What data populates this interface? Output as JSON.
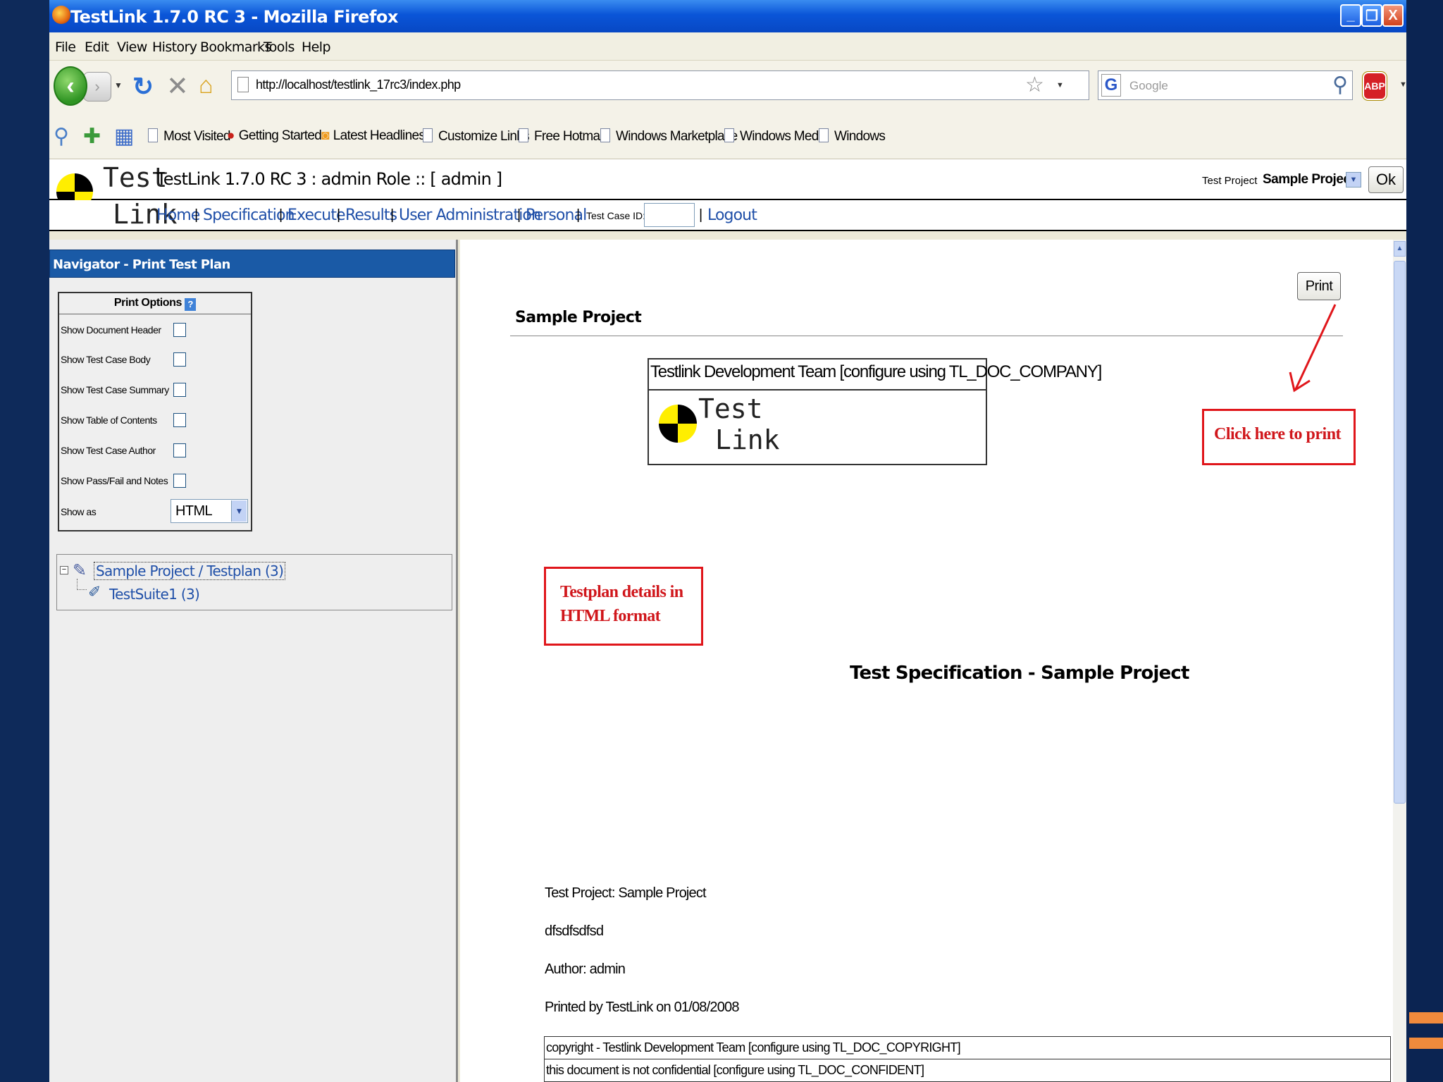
{
  "window": {
    "title": "TestLink 1.7.0 RC 3 - Mozilla Firefox",
    "minimize": "_",
    "restore": "❐",
    "close": "X"
  },
  "menu": [
    "File",
    "Edit",
    "View",
    "History",
    "Bookmarks",
    "Tools",
    "Help"
  ],
  "navbar": {
    "url": "http://localhost/testlink_17rc3/index.php",
    "search_placeholder": "Google",
    "adblock_label": "ABP"
  },
  "bookmarks": [
    "Most Visited",
    "Getting Started",
    "Latest Headlines",
    "Customize Links",
    "Free Hotmail",
    "Windows Marketplace",
    "Windows Media",
    "Windows"
  ],
  "testlink": {
    "logo_word1": "Test",
    "logo_word2": "Link",
    "title": "TestLink 1.7.0 RC 3 : admin Role :: [ admin ]",
    "test_project_label": "Test Project",
    "test_project_value": "Sample Project",
    "ok_label": "Ok",
    "nav": [
      "Home",
      "Specification",
      "Execute",
      "Results",
      "User Administration",
      "Personal"
    ],
    "test_case_id_label": "Test Case ID:",
    "logout": "Logout"
  },
  "navigator": {
    "title": "Navigator - Print Test Plan",
    "print_options_header": "Print Options",
    "help_icon": "?",
    "options": [
      {
        "label": "Show Document Header",
        "checked": false
      },
      {
        "label": "Show Test Case Body",
        "checked": false
      },
      {
        "label": "Show Test Case Summary",
        "checked": false
      },
      {
        "label": "Show Table of Contents",
        "checked": false
      },
      {
        "label": "Show Test Case Author",
        "checked": false
      },
      {
        "label": "Show Pass/Fail and Notes",
        "checked": false
      }
    ],
    "show_as_label": "Show as",
    "show_as_value": "HTML",
    "tree_root": "Sample Project / Testplan (3)",
    "tree_child": "TestSuite1 (3)"
  },
  "document": {
    "print_button": "Print",
    "project_heading": "Sample Project",
    "company": "Testlink Development Team [configure using TL_DOC_COMPANY]",
    "logo_word1": "Test",
    "logo_word2": "Link",
    "callout_print": "Click here to print",
    "callout_html": "Testplan details in HTML format",
    "spec_title": "Test Specification - Sample Project",
    "test_project_line": "Test Project: Sample Project",
    "description": "dfsdfsdfsd",
    "author_line": "Author: admin",
    "printed_by": "Printed by TestLink on 01/08/2008",
    "copyright": "copyright - Testlink Development Team [configure using TL_DOC_COPYRIGHT]",
    "confidential": "this document is not confidential [configure using TL_DOC_CONFIDENT]"
  },
  "colors": {
    "titlebar": "#0a55d8",
    "link": "#1f4fa8",
    "navigator_header": "#1a5aa6",
    "callout_red": "#e0161b"
  }
}
